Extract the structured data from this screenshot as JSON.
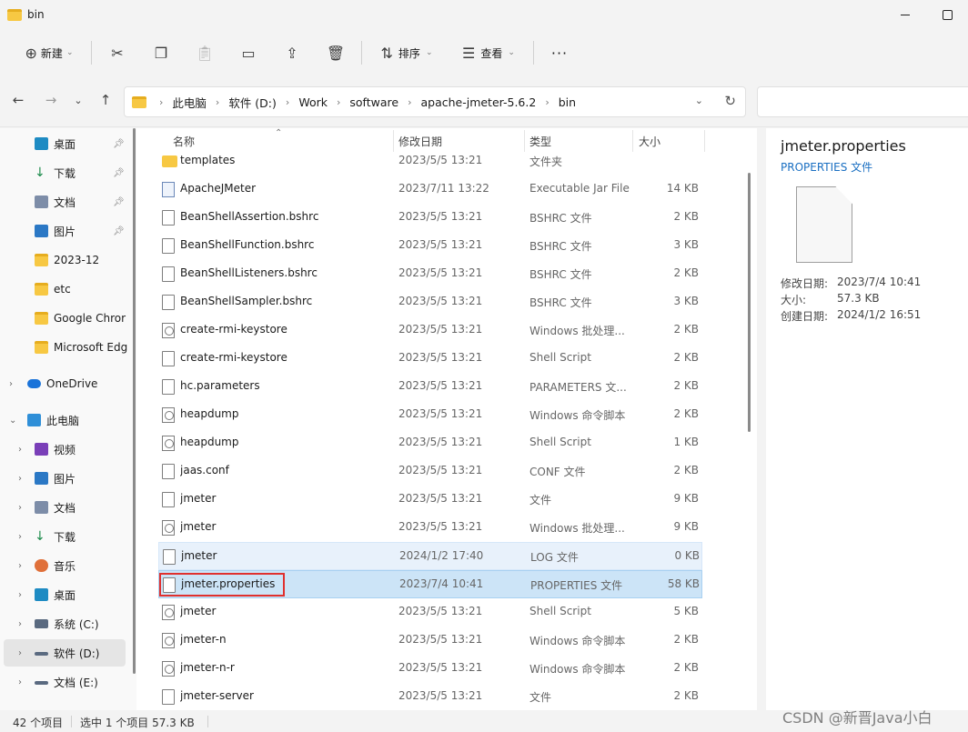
{
  "window": {
    "title": "bin"
  },
  "toolbar": {
    "new_label": "新建",
    "sort_label": "排序",
    "view_label": "查看",
    "more": "···"
  },
  "address": {
    "crumbs": [
      "此电脑",
      "软件 (D:)",
      "Work",
      "software",
      "apache-jmeter-5.6.2",
      "bin"
    ]
  },
  "sidebar": {
    "quick": [
      {
        "label": "桌面",
        "pinned": true
      },
      {
        "label": "下载",
        "pinned": true
      },
      {
        "label": "文档",
        "pinned": true
      },
      {
        "label": "图片",
        "pinned": true
      },
      {
        "label": "2023-12"
      },
      {
        "label": "etc"
      },
      {
        "label": "Google Chror"
      },
      {
        "label": "Microsoft Edg"
      }
    ],
    "onedrive": "OneDrive",
    "thispc": "此电脑",
    "pc_items": [
      "视频",
      "图片",
      "文档",
      "下载",
      "音乐",
      "桌面",
      "系统 (C:)",
      "软件 (D:)",
      "文档 (E:)"
    ]
  },
  "columns": {
    "name": "名称",
    "date": "修改日期",
    "type": "类型",
    "size": "大小"
  },
  "files": [
    {
      "name": "templates",
      "date": "2023/5/5 13:21",
      "type": "文件夹",
      "size": "",
      "icon": "folder"
    },
    {
      "name": "ApacheJMeter",
      "date": "2023/7/11 13:22",
      "type": "Executable Jar File",
      "size": "14 KB",
      "icon": "jar"
    },
    {
      "name": "BeanShellAssertion.bshrc",
      "date": "2023/5/5 13:21",
      "type": "BSHRC 文件",
      "size": "2 KB",
      "icon": "doc"
    },
    {
      "name": "BeanShellFunction.bshrc",
      "date": "2023/5/5 13:21",
      "type": "BSHRC 文件",
      "size": "3 KB",
      "icon": "doc"
    },
    {
      "name": "BeanShellListeners.bshrc",
      "date": "2023/5/5 13:21",
      "type": "BSHRC 文件",
      "size": "2 KB",
      "icon": "doc"
    },
    {
      "name": "BeanShellSampler.bshrc",
      "date": "2023/5/5 13:21",
      "type": "BSHRC 文件",
      "size": "3 KB",
      "icon": "doc"
    },
    {
      "name": "create-rmi-keystore",
      "date": "2023/5/5 13:21",
      "type": "Windows 批处理...",
      "size": "2 KB",
      "icon": "cmd"
    },
    {
      "name": "create-rmi-keystore",
      "date": "2023/5/5 13:21",
      "type": "Shell Script",
      "size": "2 KB",
      "icon": "doc"
    },
    {
      "name": "hc.parameters",
      "date": "2023/5/5 13:21",
      "type": "PARAMETERS 文...",
      "size": "2 KB",
      "icon": "doc"
    },
    {
      "name": "heapdump",
      "date": "2023/5/5 13:21",
      "type": "Windows 命令脚本",
      "size": "2 KB",
      "icon": "cmd"
    },
    {
      "name": "heapdump",
      "date": "2023/5/5 13:21",
      "type": "Shell Script",
      "size": "1 KB",
      "icon": "cmd"
    },
    {
      "name": "jaas.conf",
      "date": "2023/5/5 13:21",
      "type": "CONF 文件",
      "size": "2 KB",
      "icon": "doc"
    },
    {
      "name": "jmeter",
      "date": "2023/5/5 13:21",
      "type": "文件",
      "size": "9 KB",
      "icon": "doc"
    },
    {
      "name": "jmeter",
      "date": "2023/5/5 13:21",
      "type": "Windows 批处理...",
      "size": "9 KB",
      "icon": "cmd"
    },
    {
      "name": "jmeter",
      "date": "2024/1/2 17:40",
      "type": "LOG 文件",
      "size": "0 KB",
      "icon": "doc"
    },
    {
      "name": "jmeter.properties",
      "date": "2023/7/4 10:41",
      "type": "PROPERTIES 文件",
      "size": "58 KB",
      "icon": "doc"
    },
    {
      "name": "jmeter",
      "date": "2023/5/5 13:21",
      "type": "Shell Script",
      "size": "5 KB",
      "icon": "cmd"
    },
    {
      "name": "jmeter-n",
      "date": "2023/5/5 13:21",
      "type": "Windows 命令脚本",
      "size": "2 KB",
      "icon": "cmd"
    },
    {
      "name": "jmeter-n-r",
      "date": "2023/5/5 13:21",
      "type": "Windows 命令脚本",
      "size": "2 KB",
      "icon": "cmd"
    },
    {
      "name": "jmeter-server",
      "date": "2023/5/5 13:21",
      "type": "文件",
      "size": "2 KB",
      "icon": "doc"
    }
  ],
  "details": {
    "title": "jmeter.properties",
    "type": "PROPERTIES 文件",
    "modified_label": "修改日期:",
    "modified": "2023/7/4 10:41",
    "size_label": "大小:",
    "size": "57.3 KB",
    "created_label": "创建日期:",
    "created": "2024/1/2 16:51"
  },
  "status": {
    "count": "42 个项目",
    "selected": "选中 1 个项目  57.3 KB"
  },
  "watermark": "CSDN @新晋Java小白"
}
